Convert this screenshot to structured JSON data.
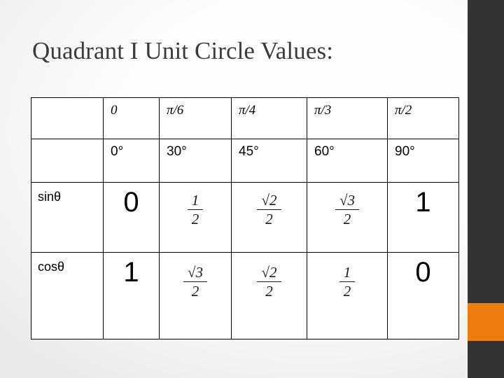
{
  "slide": {
    "title": "Quadrant I Unit Circle Values:",
    "accent_color": "#ED7D0E",
    "bar_color": "#333333"
  },
  "table": {
    "rows": {
      "radians": {
        "label": "",
        "cells": [
          "0",
          "π/6",
          "π/4",
          "π/3",
          "π/2"
        ]
      },
      "degrees": {
        "label": "",
        "cells": [
          "0°",
          "30°",
          "45°",
          "60°",
          "90°"
        ]
      },
      "sin": {
        "label": "sinθ",
        "cells": [
          {
            "kind": "integer",
            "text": "0"
          },
          {
            "kind": "fraction",
            "num": "1",
            "den": "2",
            "text": "1/2"
          },
          {
            "kind": "fraction",
            "num": "√2",
            "den": "2",
            "text": "√2/2",
            "radicand": "2"
          },
          {
            "kind": "fraction",
            "num": "√3",
            "den": "2",
            "text": "√3/2",
            "radicand": "3"
          },
          {
            "kind": "integer",
            "text": "1"
          }
        ]
      },
      "cos": {
        "label": "cosθ",
        "cells": [
          {
            "kind": "integer",
            "text": "1"
          },
          {
            "kind": "fraction",
            "num": "√3",
            "den": "2",
            "text": "√3/2",
            "radicand": "3"
          },
          {
            "kind": "fraction",
            "num": "√2",
            "den": "2",
            "text": "√2/2",
            "radicand": "2"
          },
          {
            "kind": "fraction",
            "num": "1",
            "den": "2",
            "text": "1/2"
          },
          {
            "kind": "integer",
            "text": "0"
          }
        ]
      }
    }
  }
}
